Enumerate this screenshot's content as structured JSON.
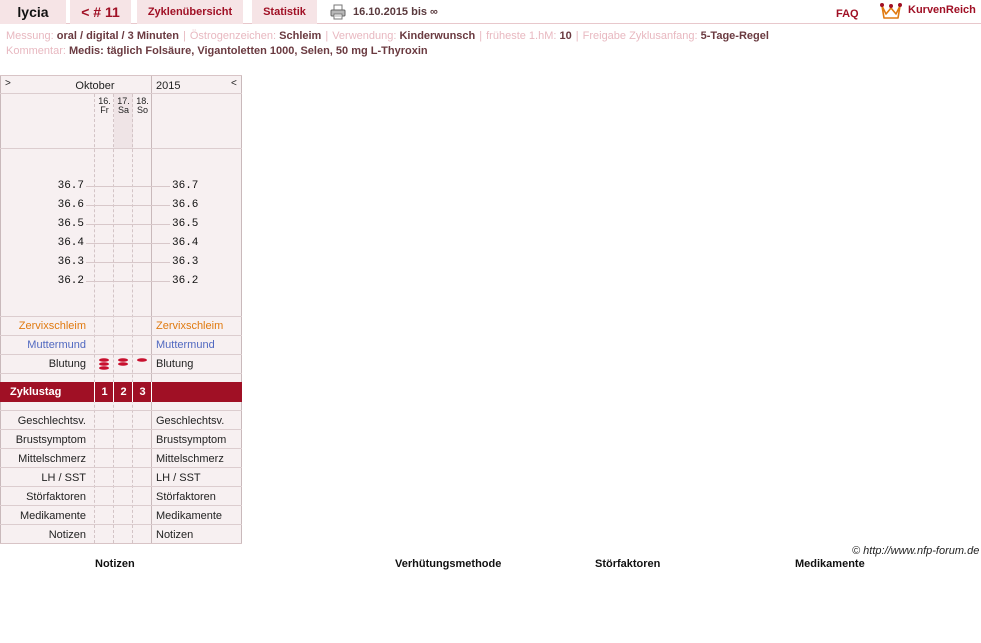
{
  "header": {
    "username": "lycia",
    "cycle_label": "< # 11",
    "overview_label": "Zyklenübersicht",
    "stats_label": "Statistik",
    "print_icon": "printer-icon",
    "date_range": "16.10.2015 bis ∞",
    "faq_label": "FAQ",
    "logo_icon": "crown-icon",
    "logo_text": "KurvenReich"
  },
  "info": {
    "messung_label": "Messung:",
    "messung_value": "oral / digital / 3 Minuten",
    "oestrogen_label": "Östrogenzeichen:",
    "oestrogen_value": "Schleim",
    "verwendung_label": "Verwendung:",
    "verwendung_value": "Kinderwunsch",
    "hm_label": "früheste 1.hM:",
    "hm_value": "10",
    "freigabe_label": "Freigabe Zyklusanfang:",
    "freigabe_value": "5-Tage-Regel",
    "kommentar_label": "Kommentar:",
    "kommentar_value": "Medis: täglich Folsäure, Vigantoletten 1000, Selen, 50 mg L-Thyroxin"
  },
  "chart": {
    "prev_btn": ">",
    "next_btn": "<",
    "month": "Oktober",
    "year": "2015",
    "days": [
      {
        "num": "16.",
        "wd": "Fr"
      },
      {
        "num": "17.",
        "wd": "Sa"
      },
      {
        "num": "18.",
        "wd": "So"
      }
    ],
    "temps": [
      "36.7",
      "36.6",
      "36.5",
      "36.4",
      "36.3",
      "36.2"
    ],
    "rows_top": {
      "zervix": "Zervixschleim",
      "muttermund": "Muttermund",
      "blutung": "Blutung"
    },
    "bleeding": [
      "heavy",
      "medium",
      "light"
    ],
    "zyklustag_label": "Zyklustag",
    "zyklustag_days": [
      "1",
      "2",
      "3"
    ],
    "rows_bottom": [
      "Geschlechtsv.",
      "Brustsymptom",
      "Mittelschmerz",
      "LH / SST",
      "Störfaktoren",
      "Medikamente",
      "Notizen"
    ],
    "accent_color": "#a01025"
  },
  "footer": {
    "copyright": "© http://www.nfp-forum.de",
    "headings": [
      "Notizen",
      "Verhütungsmethode",
      "Störfaktoren",
      "Medikamente"
    ]
  }
}
